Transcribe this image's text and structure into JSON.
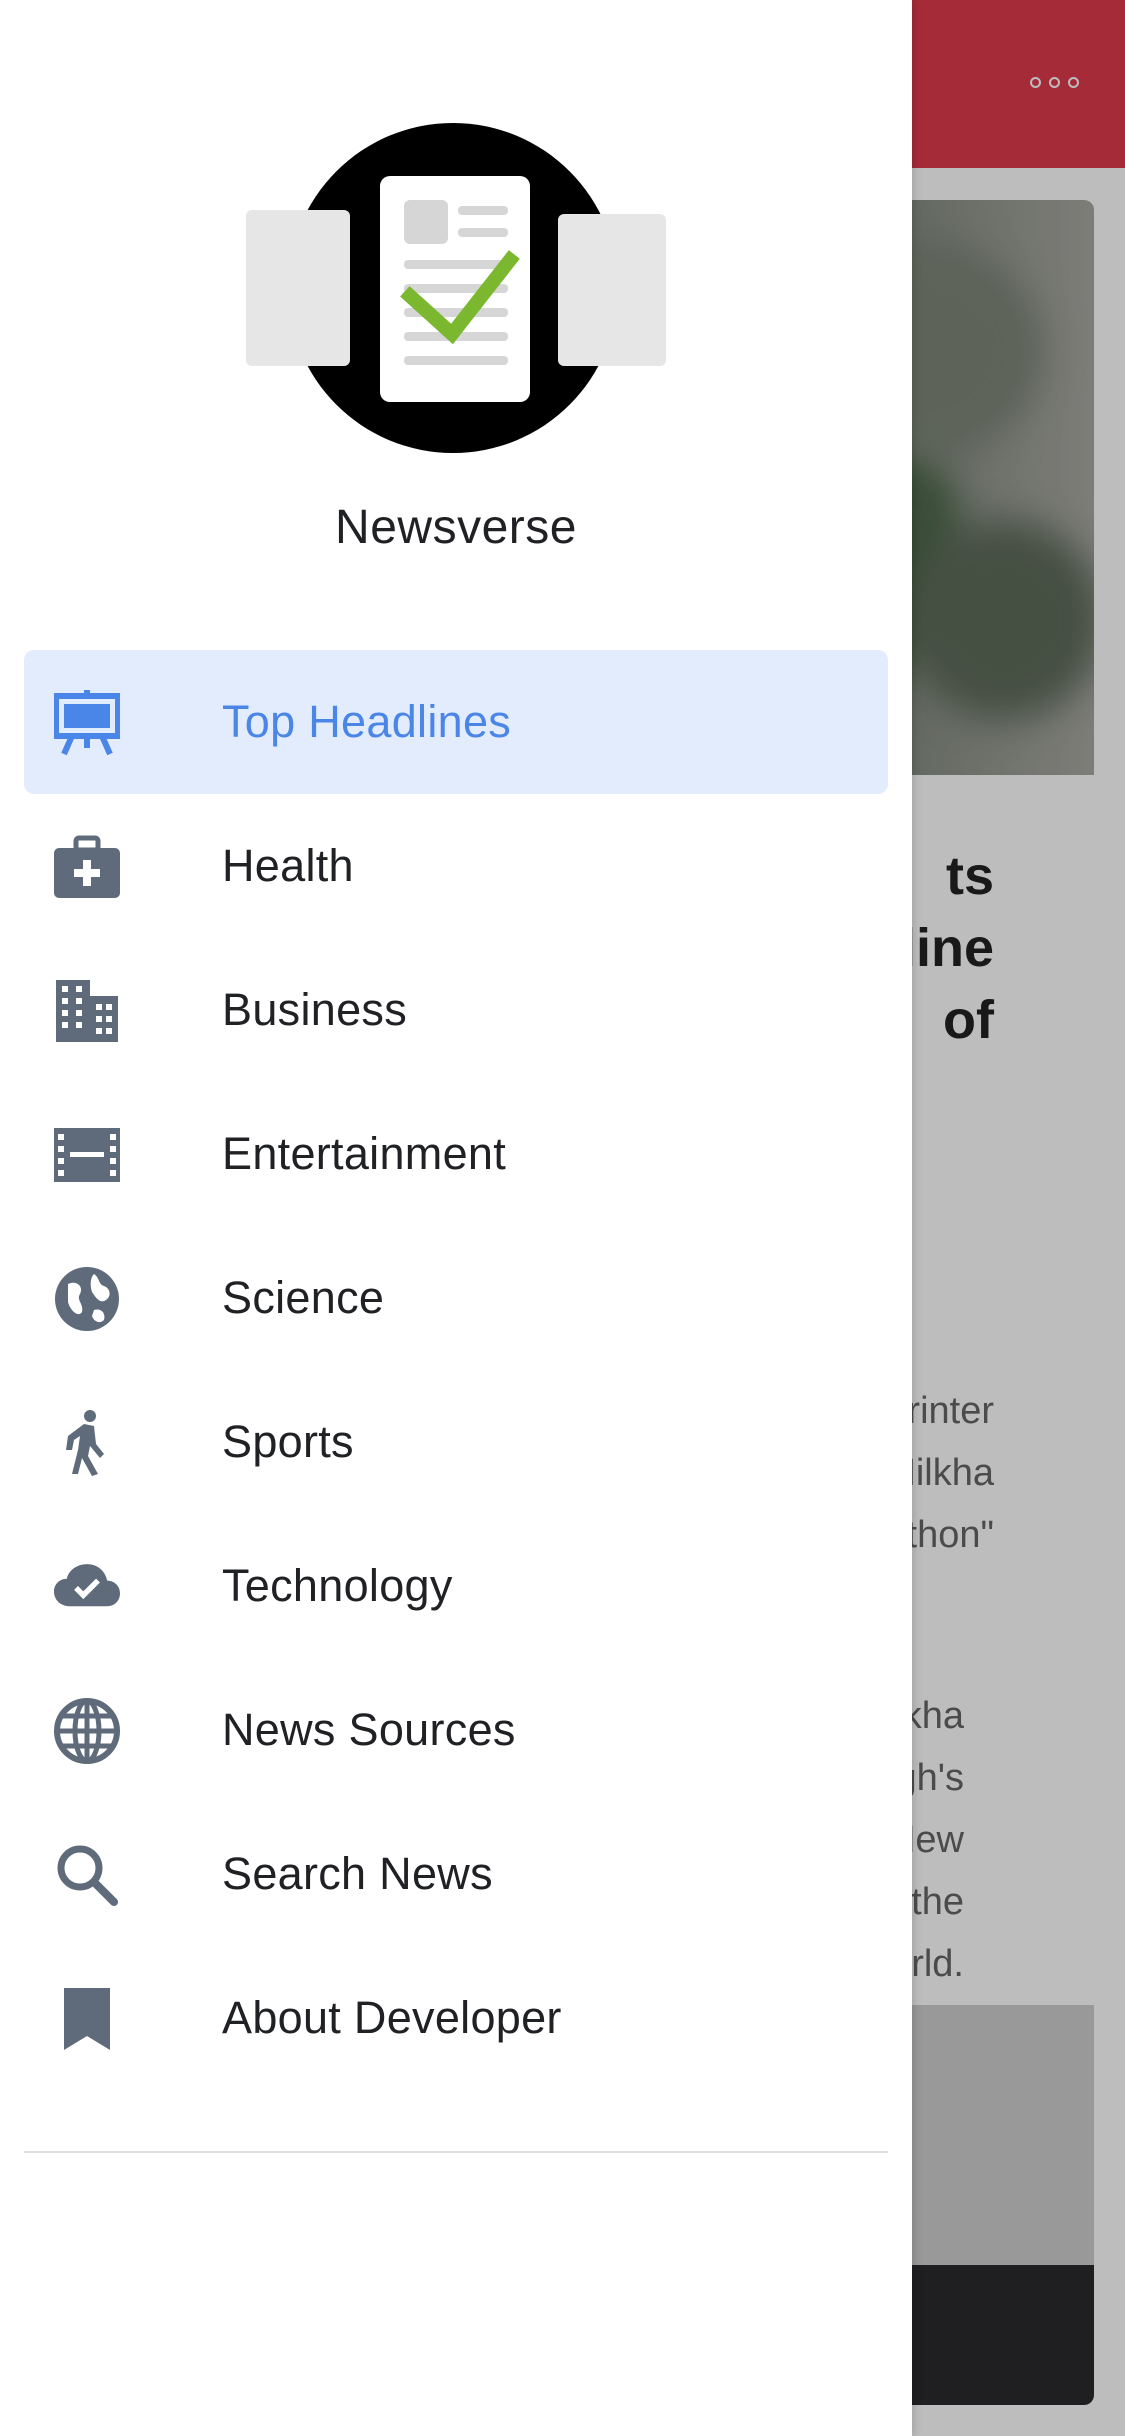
{
  "app": {
    "name": "Newsverse"
  },
  "colors": {
    "appbar": "#e03a4e",
    "active_item_bg": "#e3ecfc",
    "active_item_text": "#4a86e8",
    "icon_gray": "#5f6b7a",
    "logo_check_green": "#7cb82f"
  },
  "drawer": {
    "items": [
      {
        "label": "Top Headlines",
        "icon": "presentation-easel-icon",
        "active": true
      },
      {
        "label": "Health",
        "icon": "first-aid-kit-icon",
        "active": false
      },
      {
        "label": "Business",
        "icon": "office-building-icon",
        "active": false
      },
      {
        "label": "Entertainment",
        "icon": "film-strip-icon",
        "active": false
      },
      {
        "label": "Science",
        "icon": "globe-earth-icon",
        "active": false
      },
      {
        "label": "Sports",
        "icon": "person-walking-icon",
        "active": false
      },
      {
        "label": "Technology",
        "icon": "cloud-check-icon",
        "active": false
      },
      {
        "label": "News Sources",
        "icon": "world-grid-icon",
        "active": false
      },
      {
        "label": "Search News",
        "icon": "search-icon",
        "active": false
      },
      {
        "label": "About Developer",
        "icon": "bookmark-icon",
        "active": false
      }
    ]
  },
  "background": {
    "appbar_menu_icon": "more-horizontal-icon",
    "headline_fragment": "ts\ntline\n of",
    "subtitle_fragment": "printer\nMilkha\nthon\"",
    "description_fragment": "kha\nSingh's\nNew\ng the\nrld."
  }
}
